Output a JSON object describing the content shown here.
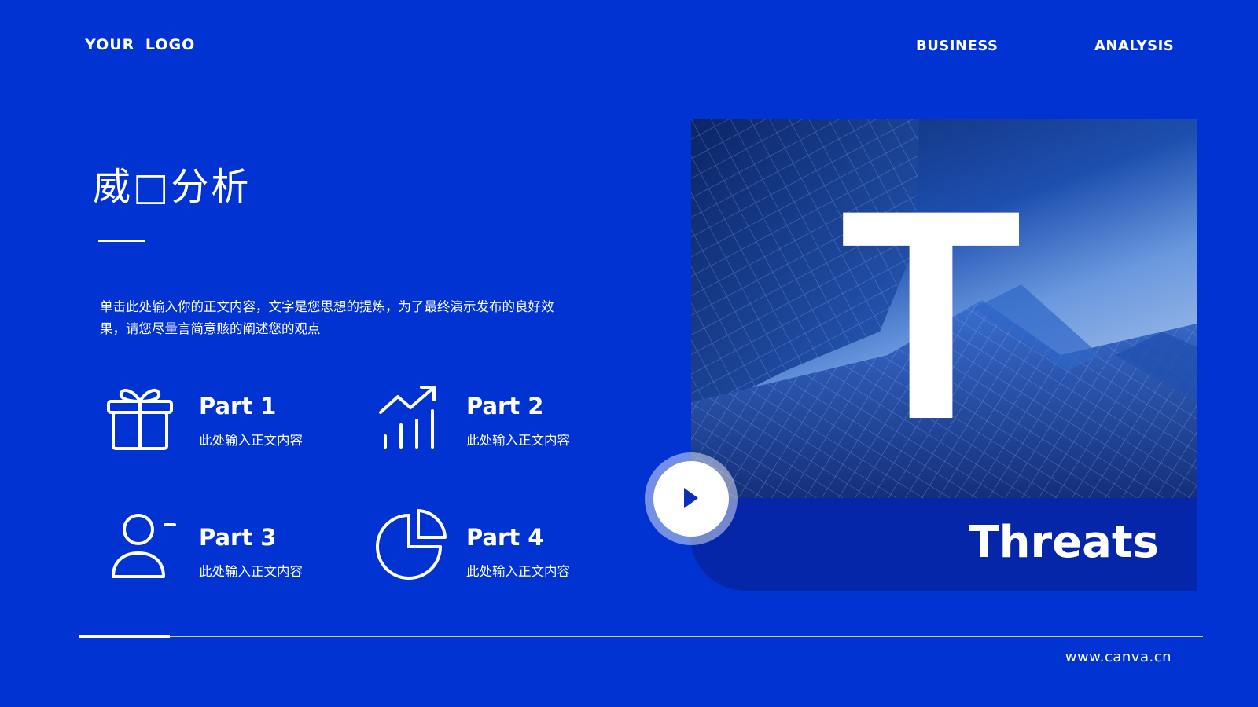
{
  "header": {
    "logo": "YOUR  LOGO",
    "nav": [
      "BUSINESS",
      "ANALYSIS"
    ]
  },
  "main": {
    "title": "威□分析",
    "body": "单击此处输入你的正文内容，文字是您思想的提炼，为了最终演示发布的良好效果，请您尽量言简意赅的阐述您的观点",
    "features": [
      {
        "title": "Part 1",
        "desc": "此处输入正文内容",
        "icon": "gift-icon"
      },
      {
        "title": "Part 2",
        "desc": "此处输入正文内容",
        "icon": "trend-chart-icon"
      },
      {
        "title": "Part 3",
        "desc": "此处输入正文内容",
        "icon": "user-remove-icon"
      },
      {
        "title": "Part 4",
        "desc": "此处输入正文内容",
        "icon": "pie-chart-icon"
      }
    ]
  },
  "hero": {
    "letter": "T",
    "caption": "Threats",
    "image": "glass-skyscrapers-photo",
    "play_icon": "play-icon"
  },
  "footer": {
    "url": "www.canva.cn"
  },
  "colors": {
    "background": "#0033d1",
    "band": "#0526a8",
    "text": "#ffffff"
  }
}
